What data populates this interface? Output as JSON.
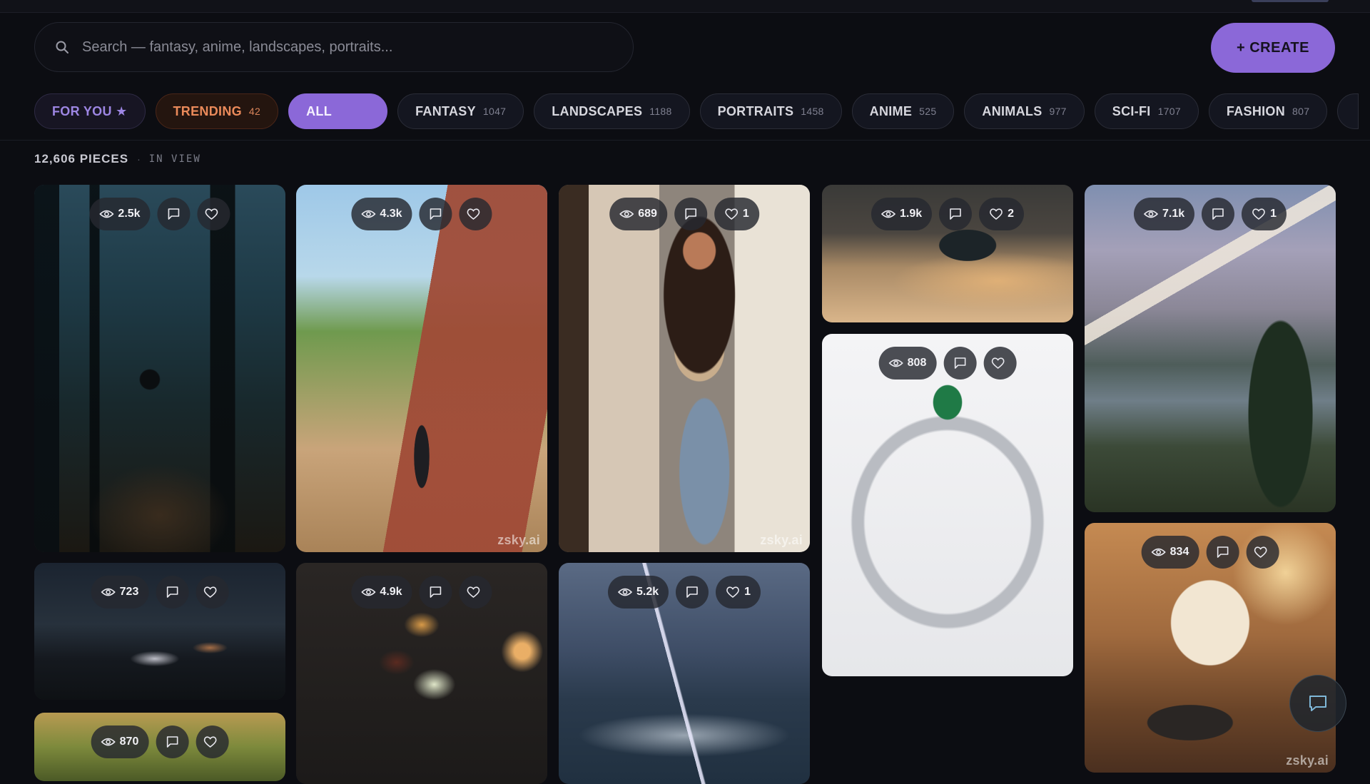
{
  "search": {
    "placeholder": "Search — fantasy, anime, landscapes, portraits...",
    "icon": "search-icon"
  },
  "create_button": {
    "label": "+ CREATE"
  },
  "filters": [
    {
      "label": "FOR YOU ★",
      "count": ""
    },
    {
      "label": "TRENDING",
      "count": "42"
    },
    {
      "label": "ALL",
      "count": ""
    },
    {
      "label": "FANTASY",
      "count": "1047"
    },
    {
      "label": "LANDSCAPES",
      "count": "1188"
    },
    {
      "label": "PORTRAITS",
      "count": "1458"
    },
    {
      "label": "ANIME",
      "count": "525"
    },
    {
      "label": "ANIMALS",
      "count": "977"
    },
    {
      "label": "SCI-FI",
      "count": "1707"
    },
    {
      "label": "FASHION",
      "count": "807"
    }
  ],
  "active_filter": "ALL",
  "summary": {
    "pieces": "12,606 PIECES",
    "separator": "·",
    "in_view": "IN VIEW"
  },
  "cards": [
    {
      "id": "forest",
      "views": "2.5k",
      "likes": "",
      "watermark": ""
    },
    {
      "id": "street-anime",
      "views": "4.3k",
      "likes": "",
      "watermark": "zsky.ai"
    },
    {
      "id": "portrait-woman",
      "views": "689",
      "likes": "1",
      "watermark": "zsky.ai"
    },
    {
      "id": "race-car",
      "views": "1.9k",
      "likes": "2",
      "watermark": ""
    },
    {
      "id": "mountain-lake",
      "views": "7.1k",
      "likes": "1",
      "watermark": ""
    },
    {
      "id": "emerald-ring",
      "views": "808",
      "likes": "",
      "watermark": ""
    },
    {
      "id": "night-street",
      "views": "723",
      "likes": "",
      "watermark": ""
    },
    {
      "id": "flying-food",
      "views": "4.9k",
      "likes": "",
      "watermark": ""
    },
    {
      "id": "storm-sea",
      "views": "5.2k",
      "likes": "1",
      "watermark": ""
    },
    {
      "id": "cooking-mascot",
      "views": "834",
      "likes": "",
      "watermark": "zsky.ai"
    },
    {
      "id": "meadow",
      "views": "870",
      "likes": "",
      "watermark": ""
    }
  ],
  "colors": {
    "accent": "#8b68d8",
    "trending": "#ea8a5a",
    "background": "#0c0d12"
  },
  "chat_button": {
    "icon": "chat-bubble-icon"
  }
}
